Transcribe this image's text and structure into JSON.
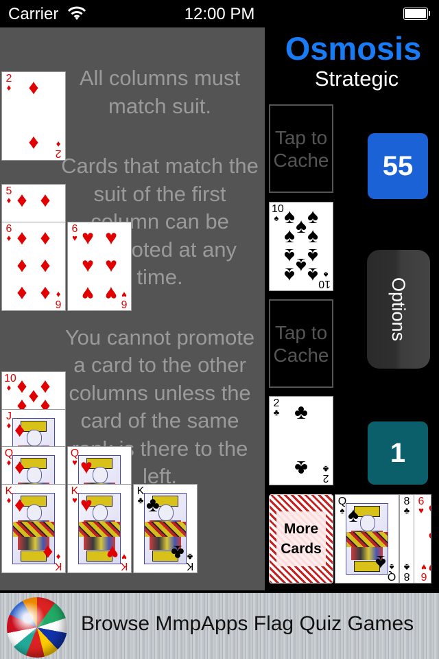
{
  "status_bar": {
    "carrier": "Carrier",
    "time": "12:00 PM",
    "wifi_icon": "wifi-icon",
    "battery_icon": "battery-icon"
  },
  "game": {
    "title": "Osmosis",
    "subtitle": "Strategic",
    "score": "55",
    "count": "1",
    "options_label": "Options",
    "more_cards_label_line1": "More",
    "more_cards_label_line2": "Cards",
    "cache_slots": [
      {
        "line1": "Tap to",
        "line2": "Cache"
      },
      {
        "line1": "Tap to",
        "line2": "Cache"
      }
    ],
    "reserve_cards": [
      {
        "rank": "10",
        "suit": "♠",
        "color": "black"
      },
      {
        "rank": "2",
        "suit": "♣",
        "color": "black"
      }
    ],
    "waste_cards": [
      {
        "rank": "Q",
        "suit": "♠",
        "color": "black"
      },
      {
        "rank": "8",
        "suit": "♣",
        "color": "black"
      },
      {
        "rank": "6",
        "suit": "♥",
        "color": "red"
      }
    ]
  },
  "instructions": {
    "p1": "All columns must match suit.",
    "p2": "Cards that match the suit of the first column can be promoted at any time.",
    "p3": "You cannot promote a card to the other columns unless the card of the same rank is there to the left."
  },
  "foundations": [
    {
      "row": 1,
      "cards": [
        [
          {
            "rank": "2",
            "suit": "♦",
            "color": "red"
          }
        ]
      ]
    },
    {
      "row": 2,
      "cards": [
        [
          {
            "rank": "5",
            "suit": "♦",
            "color": "red"
          },
          {
            "rank": "6",
            "suit": "♦",
            "color": "red"
          }
        ],
        [
          {
            "rank": "6",
            "suit": "♥",
            "color": "red"
          }
        ]
      ]
    },
    {
      "row": 3,
      "cards": [
        [
          {
            "rank": "10",
            "suit": "♦",
            "color": "red"
          },
          {
            "rank": "J",
            "suit": "♦",
            "color": "red"
          },
          {
            "rank": "Q",
            "suit": "♦",
            "color": "red"
          },
          {
            "rank": "K",
            "suit": "♦",
            "color": "red"
          }
        ],
        [
          {
            "rank": "Q",
            "suit": "♥",
            "color": "red"
          },
          {
            "rank": "K",
            "suit": "♥",
            "color": "red"
          }
        ],
        [
          {
            "rank": "K",
            "suit": "♣",
            "color": "black"
          }
        ]
      ]
    }
  ],
  "banner": {
    "text": "Browse MmpApps Flag Quiz Games",
    "icon": "flag-globe-icon"
  }
}
